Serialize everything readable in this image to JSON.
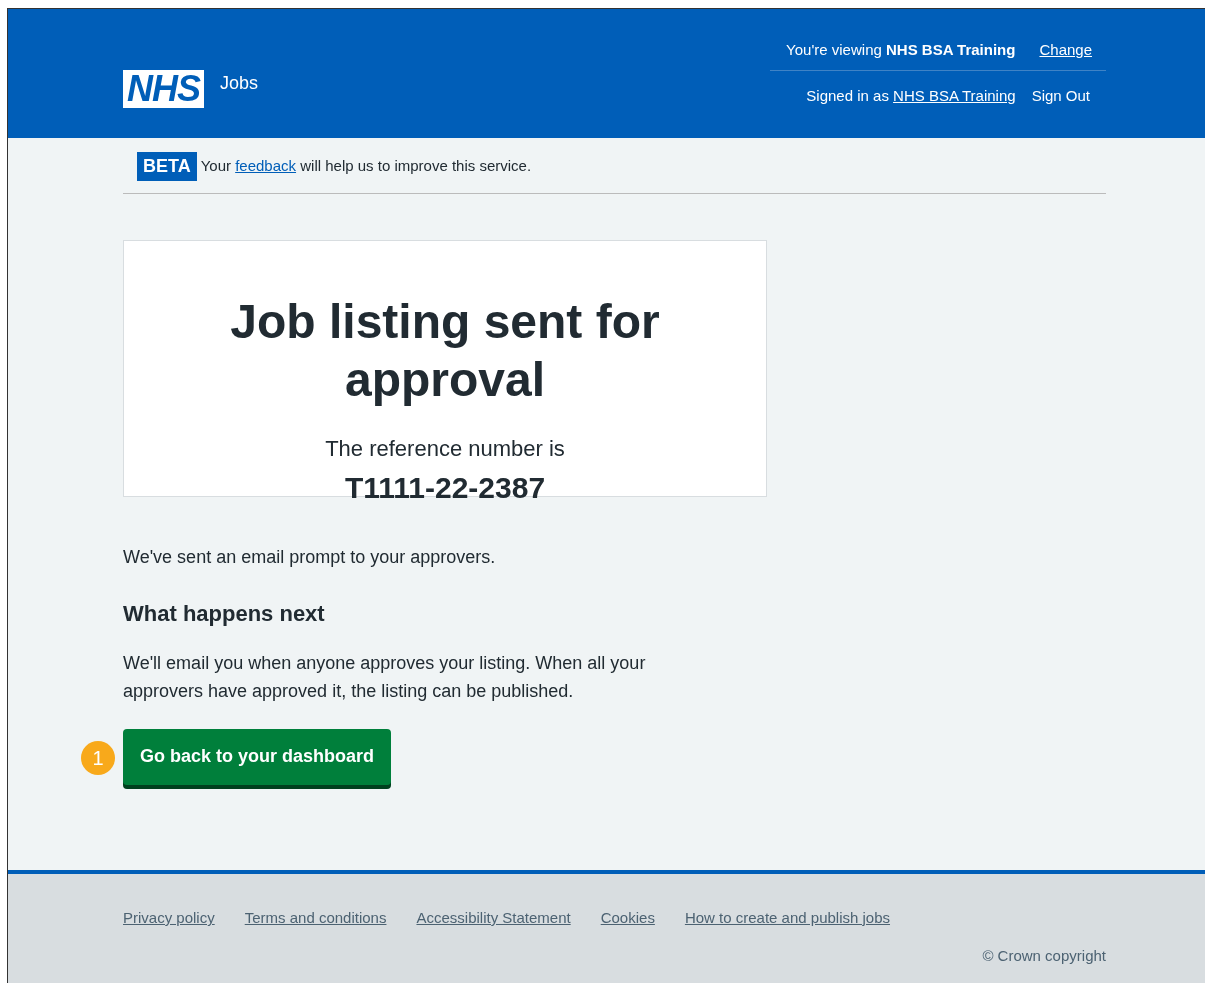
{
  "header": {
    "logo": "NHS",
    "service": "Jobs",
    "viewing_prefix": "You're viewing",
    "organisation": "NHS BSA Training",
    "change_link": "Change",
    "signed_in_prefix": "Signed in as",
    "user_link": "NHS BSA Training",
    "sign_out": "Sign Out"
  },
  "phase_banner": {
    "tag": "BETA",
    "before": "Your",
    "link": "feedback",
    "after": "will help us to improve this service."
  },
  "panel": {
    "title": "Job listing sent for approval",
    "subtitle": "The reference number is",
    "reference": "T1111-22-2387"
  },
  "body": {
    "intro": "We've sent an email prompt to your approvers.",
    "heading": "What happens next",
    "paragraph": "We'll email you when anyone approves your listing. When all your approvers have approved it, the listing can be published."
  },
  "button": {
    "label": "Go back to your dashboard",
    "marker": "1"
  },
  "footer": {
    "links": [
      "Privacy policy",
      "Terms and conditions",
      "Accessibility Statement",
      "Cookies",
      "How to create and publish jobs"
    ],
    "copyright": "© Crown copyright"
  }
}
